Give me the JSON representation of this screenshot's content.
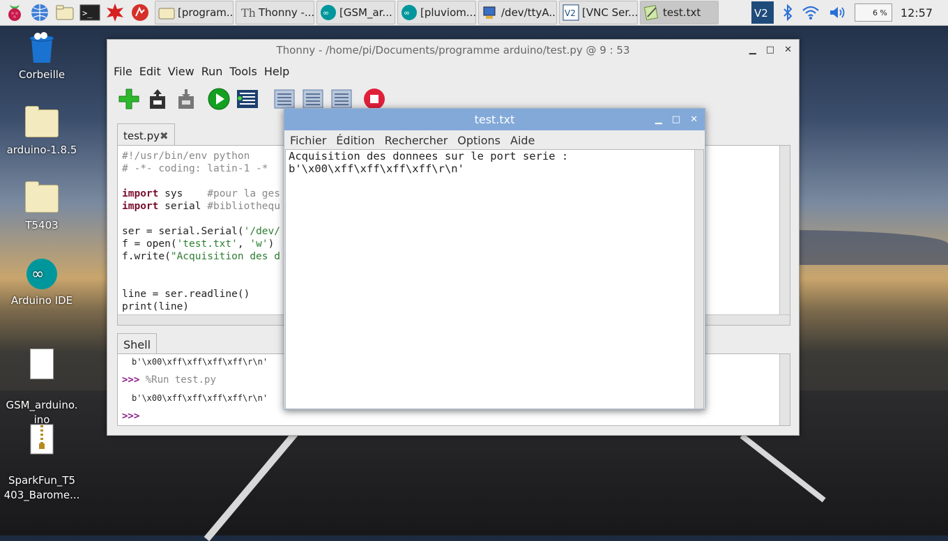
{
  "taskbar": {
    "tasks": [
      {
        "label": "[program...",
        "icon": "folder-icon"
      },
      {
        "label": "Thonny  -...",
        "icon": "thonny-icon"
      },
      {
        "label": "[GSM_ar...",
        "icon": "arduino-icon"
      },
      {
        "label": "[pluviom...",
        "icon": "arduino-icon"
      },
      {
        "label": "/dev/ttyA...",
        "icon": "serial-monitor-icon"
      },
      {
        "label": "[VNC Ser...",
        "icon": "vnc-icon"
      },
      {
        "label": "test.txt",
        "icon": "text-editor-icon"
      }
    ],
    "cpu": "6 %",
    "clock": "12:57",
    "colors": {
      "bar": "#ececec",
      "vnc": "#1f4b7a",
      "arduino": "#00979c"
    }
  },
  "desktop": {
    "icons": [
      {
        "label": "Corbeille",
        "icon": "trash-icon"
      },
      {
        "label": "arduino-1.8.5",
        "icon": "folder-icon"
      },
      {
        "label": "T5403",
        "icon": "folder-icon"
      },
      {
        "label": "Arduino IDE",
        "icon": "arduino-icon"
      },
      {
        "label": "GSM_arduino.\nino",
        "icon": "document-icon"
      },
      {
        "label": "SparkFun_T5\n403_Barome...",
        "icon": "zip-icon"
      }
    ]
  },
  "thonny": {
    "title": "Thonny  -  /home/pi/Documents/programme arduino/test.py  @  9 : 53",
    "menu": [
      "File",
      "Edit",
      "View",
      "Run",
      "Tools",
      "Help"
    ],
    "toolbar": [
      "new-file",
      "open-file",
      "save-file",
      "run",
      "debug",
      "step-over",
      "step-into",
      "step-out",
      "stop"
    ],
    "editor_tab": "test.py",
    "code": {
      "l1": "#!/usr/bin/env python",
      "l2": "# -*- coding: latin-1 -*",
      "l4_kw": "import",
      "l4_mod": " sys    ",
      "l4_cm": "#pour la ges",
      "l5_kw": "import",
      "l5_mod": " serial ",
      "l5_cm": "#bibliothequ",
      "l7_a": "ser = serial.Serial(",
      "l7_s": "'/dev/",
      "l8_a": "f = open(",
      "l8_s1": "'test.txt'",
      "l8_b": ", ",
      "l8_s2": "'w'",
      "l8_c": ")",
      "l9_a": "f.write(",
      "l9_s": "\"Acquisition des d",
      "l12": "line = ser.readline()",
      "l13": "print(line)"
    },
    "shell_tab": "Shell",
    "shell": {
      "out1": "b'\\x00\\xff\\xff\\xff\\xff\\r\\n'",
      "prompt": ">>>",
      "run_cmd": " %Run test.py",
      "out2": "b'\\x00\\xff\\xff\\xff\\xff\\r\\n'",
      "prompt2": ">>>"
    },
    "colors": {
      "keyword": "#7a0e2e",
      "string": "#2e7d32",
      "comment": "#888888",
      "prompt": "#8b1f8b"
    }
  },
  "notepad": {
    "title": "test.txt",
    "menu": [
      "Fichier",
      "Édition",
      "Rechercher",
      "Options",
      "Aide"
    ],
    "line1": "Acquisition des donnees sur le port serie :",
    "line2": "b'\\x00\\xff\\xff\\xff\\xff\\r\\n'",
    "colors": {
      "titlebar": "#83a9d9"
    }
  }
}
